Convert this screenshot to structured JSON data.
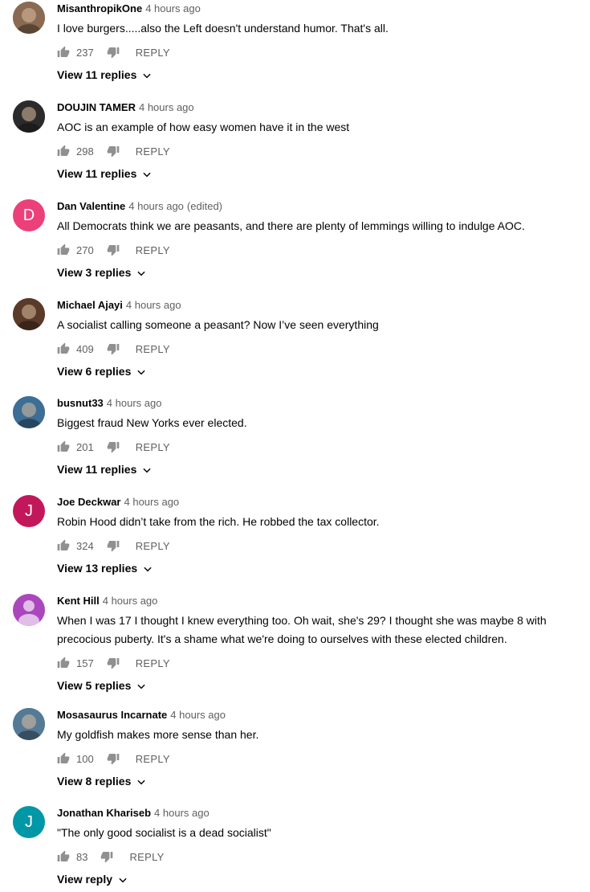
{
  "comments": [
    {
      "author": "MisanthropikOne",
      "time": "4 hours ago",
      "edited": "",
      "text": "I love burgers.....also the Left doesn't understand humor. That's all.",
      "likes": "237",
      "reply_label": "REPLY",
      "view_replies": "View 11 replies",
      "avatar": {
        "type": "photo",
        "color": "#8a6a52"
      }
    },
    {
      "author": "DOUJIN TAMER",
      "time": "4 hours ago",
      "edited": "",
      "text": "AOC is an example of how easy women have it in the west",
      "likes": "298",
      "reply_label": "REPLY",
      "view_replies": "View 11 replies",
      "avatar": {
        "type": "photo",
        "color": "#2b2b2b"
      }
    },
    {
      "author": "Dan Valentine",
      "time": "4 hours ago",
      "edited": "(edited)",
      "text": "All Democrats think we are peasants, and there are plenty of lemmings willing to indulge AOC.",
      "likes": "270",
      "reply_label": "REPLY",
      "view_replies": "View 3 replies",
      "avatar": {
        "type": "letter",
        "letter": "D",
        "color": "#ec407a"
      }
    },
    {
      "author": "Michael Ajayi",
      "time": "4 hours ago",
      "edited": "",
      "text": "A socialist calling someone a peasant? Now I’ve seen everything",
      "likes": "409",
      "reply_label": "REPLY",
      "view_replies": "View 6 replies",
      "avatar": {
        "type": "photo",
        "color": "#5a3a28"
      }
    },
    {
      "author": "busnut33",
      "time": "4 hours ago",
      "edited": "",
      "text": "Biggest fraud New Yorks ever elected.",
      "likes": "201",
      "reply_label": "REPLY",
      "view_replies": "View 11 replies",
      "avatar": {
        "type": "photo",
        "color": "#3d6e95"
      }
    },
    {
      "author": "Joe Deckwar",
      "time": "4 hours ago",
      "edited": "",
      "text": "Robin Hood didn’t take from the rich.  He robbed the tax collector.",
      "likes": "324",
      "reply_label": "REPLY",
      "view_replies": "View 13 replies",
      "avatar": {
        "type": "letter",
        "letter": "J",
        "color": "#c2185b"
      }
    },
    {
      "author": "Kent Hill",
      "time": "4 hours ago",
      "edited": "",
      "text": "When I was 17 I thought I knew everything too. Oh wait, she's 29? I thought she was maybe 8 with precocious puberty. It's a shame what we're doing to ourselves with these elected children.",
      "likes": "157",
      "reply_label": "REPLY",
      "view_replies": "View 5 replies",
      "avatar": {
        "type": "silhouette",
        "color": "#ab47bc"
      }
    },
    {
      "author": "Mosasaurus Incarnate",
      "time": "4 hours ago",
      "edited": "",
      "text": "My goldfish makes more sense than her.",
      "likes": "100",
      "reply_label": "REPLY",
      "view_replies": "View 8 replies",
      "avatar": {
        "type": "photo",
        "color": "#557a95"
      }
    },
    {
      "author": "Jonathan Khariseb",
      "time": "4 hours ago",
      "edited": "",
      "text": "\"The only good socialist is a dead socialist\"",
      "likes": "83",
      "reply_label": "REPLY",
      "view_replies": "View reply",
      "avatar": {
        "type": "letter",
        "letter": "J",
        "color": "#0097a7"
      }
    }
  ]
}
